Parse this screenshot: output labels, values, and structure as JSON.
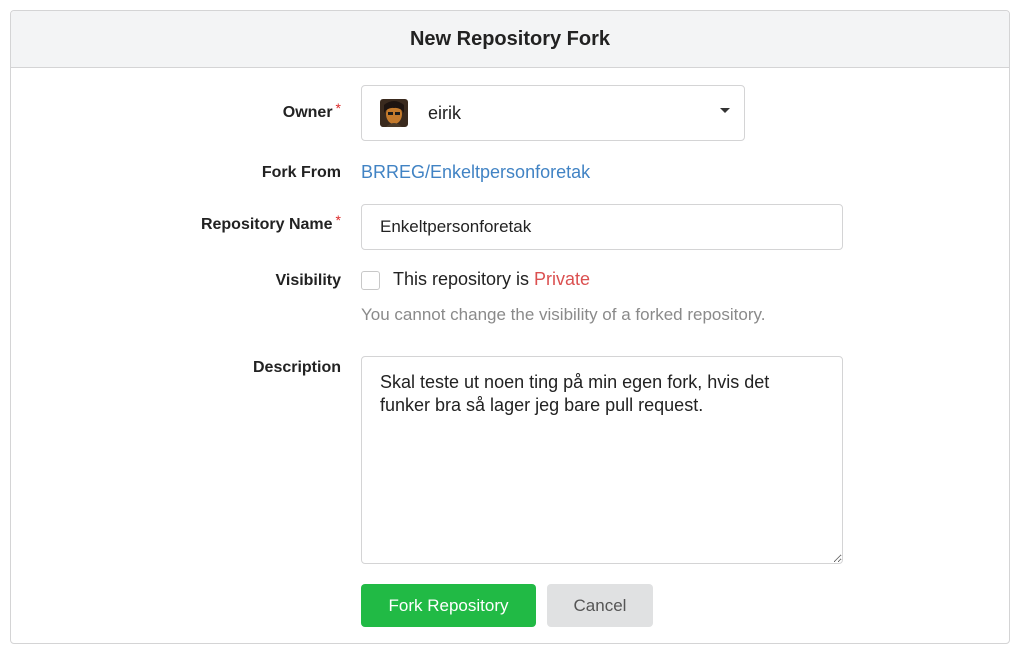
{
  "header": {
    "title": "New Repository Fork"
  },
  "form": {
    "owner": {
      "label": "Owner",
      "required_marker": "*",
      "value": "eirik",
      "avatar_icon": "user-avatar"
    },
    "fork_from": {
      "label": "Fork From",
      "value": "BRREG/Enkeltpersonforetak"
    },
    "repository_name": {
      "label": "Repository Name",
      "required_marker": "*",
      "value": "Enkeltpersonforetak"
    },
    "visibility": {
      "label": "Visibility",
      "checkbox_text": "This repository is ",
      "checkbox_emphasis": "Private",
      "checked": false,
      "help_text": "You cannot change the visibility of a forked repository."
    },
    "description": {
      "label": "Description",
      "value": "Skal teste ut noen ting på min egen fork, hvis det funker bra så lager jeg bare pull request."
    }
  },
  "actions": {
    "fork_label": "Fork Repository",
    "cancel_label": "Cancel"
  },
  "colors": {
    "primary": "#21ba45",
    "link": "#4183c4",
    "required": "#db2828",
    "private": "#db5050"
  }
}
